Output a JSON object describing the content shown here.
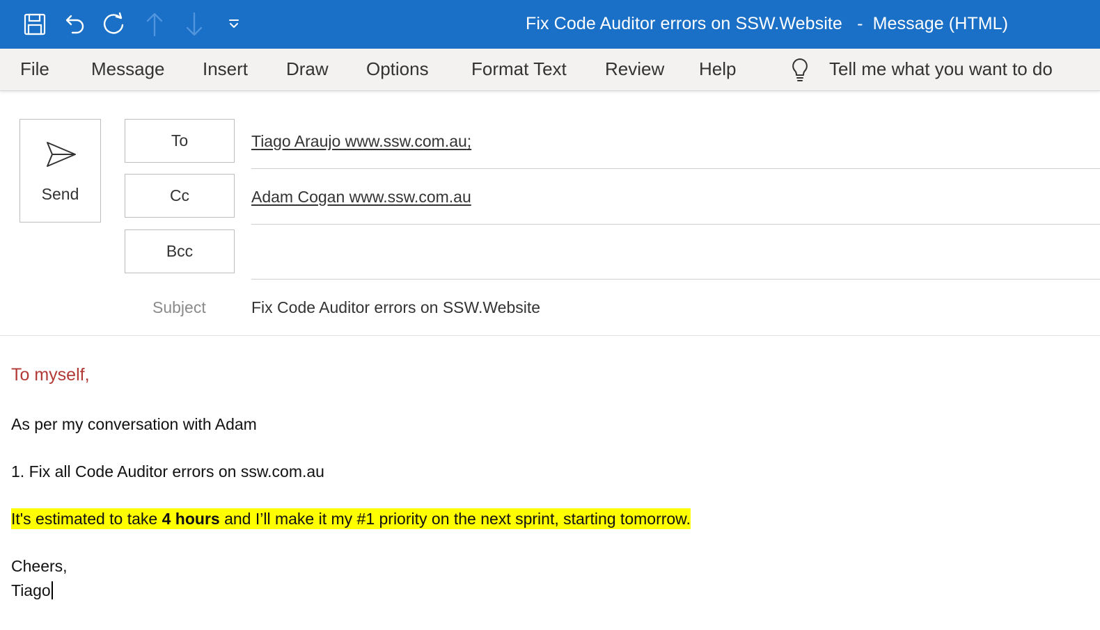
{
  "window": {
    "title": "Fix Code Auditor errors on SSW.Website",
    "title_separator": "-",
    "mode": "Message (HTML)",
    "accent_color": "#1a6fc6"
  },
  "quick_access": {
    "icons": [
      "save-icon",
      "undo-icon",
      "redo-icon",
      "previous-item-icon",
      "next-item-icon",
      "customize-toolbar-icon"
    ]
  },
  "ribbon": {
    "tabs": [
      "File",
      "Message",
      "Insert",
      "Draw",
      "Options",
      "Format Text",
      "Review",
      "Help"
    ],
    "tell_me": "Tell me what you want to do"
  },
  "compose": {
    "send_label": "Send",
    "to_label": "To",
    "cc_label": "Cc",
    "bcc_label": "Bcc",
    "to_value": "Tiago Araujo www.ssw.com.au",
    "to_separator": ";",
    "cc_value": "Adam Cogan www.ssw.com.au",
    "bcc_value": "",
    "subject_label": "Subject",
    "subject_value": "Fix Code Auditor errors on SSW.Website"
  },
  "body": {
    "greeting": "To myself,",
    "intro": "As per my conversation with Adam",
    "item_1": "1. Fix all Code Auditor errors on ssw.com.au",
    "estimate_before": "It's estimated to take ",
    "estimate_bold": "4 hours",
    "estimate_after": " and I’ll make it my #1 priority on the next sprint, starting tomorrow.",
    "closing": "Cheers,",
    "signature": "Tiago",
    "highlight_color": "#ffff00",
    "greeting_color": "#b23a36"
  }
}
